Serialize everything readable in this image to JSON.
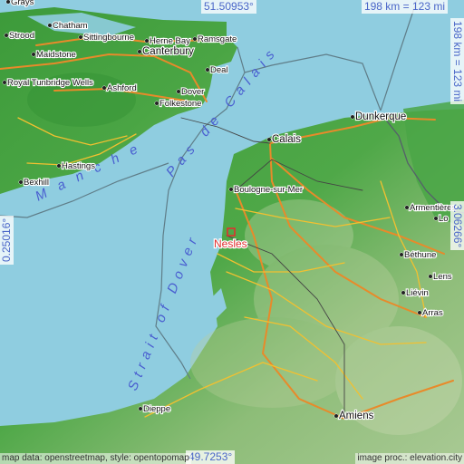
{
  "coordinates": {
    "top": "51.50953°",
    "bottom": "49.7253°",
    "left": "0.25016°",
    "right": "3.06266°"
  },
  "scale": {
    "top": "198 km = 123 mi",
    "right": "198 km = 123 mi"
  },
  "credits": {
    "left": "map data: openstreetmap, style: opentopomap",
    "right": "image proc.: elevation.city"
  },
  "highlight": {
    "name": "Nesles",
    "color": "#e03030"
  },
  "sea_labels": {
    "manche": "Manche",
    "pas_de_calais": "Pas de Calais",
    "strait_of_dover": "Strait of Dover"
  },
  "places": [
    {
      "name": "Grays"
    },
    {
      "name": "Chatham"
    },
    {
      "name": "Strood"
    },
    {
      "name": "Maidstone"
    },
    {
      "name": "Sittingbourne"
    },
    {
      "name": "Herne Bay"
    },
    {
      "name": "Ramsgate"
    },
    {
      "name": "Canterbury"
    },
    {
      "name": "Deal"
    },
    {
      "name": "Royal Tunbridge Wells"
    },
    {
      "name": "Ashford"
    },
    {
      "name": "Dover"
    },
    {
      "name": "Folkestone"
    },
    {
      "name": "Hastings"
    },
    {
      "name": "Bexhill"
    },
    {
      "name": "Calais"
    },
    {
      "name": "Dunkerque"
    },
    {
      "name": "Boulogne-sur-Mer"
    },
    {
      "name": "Armentières"
    },
    {
      "name": "Béthune"
    },
    {
      "name": "Liévin"
    },
    {
      "name": "Arras"
    },
    {
      "name": "Amiens"
    },
    {
      "name": "Dieppe"
    },
    {
      "name": "Lo"
    },
    {
      "name": "Lens"
    }
  ],
  "colors": {
    "sea": "#8fcde0",
    "land_low": "#3c9a3a",
    "land_high": "#9dc58a",
    "road": "#f2c030",
    "highway": "#e88a2a",
    "border": "#5a6b78",
    "label_blue": "#4a66c8"
  }
}
